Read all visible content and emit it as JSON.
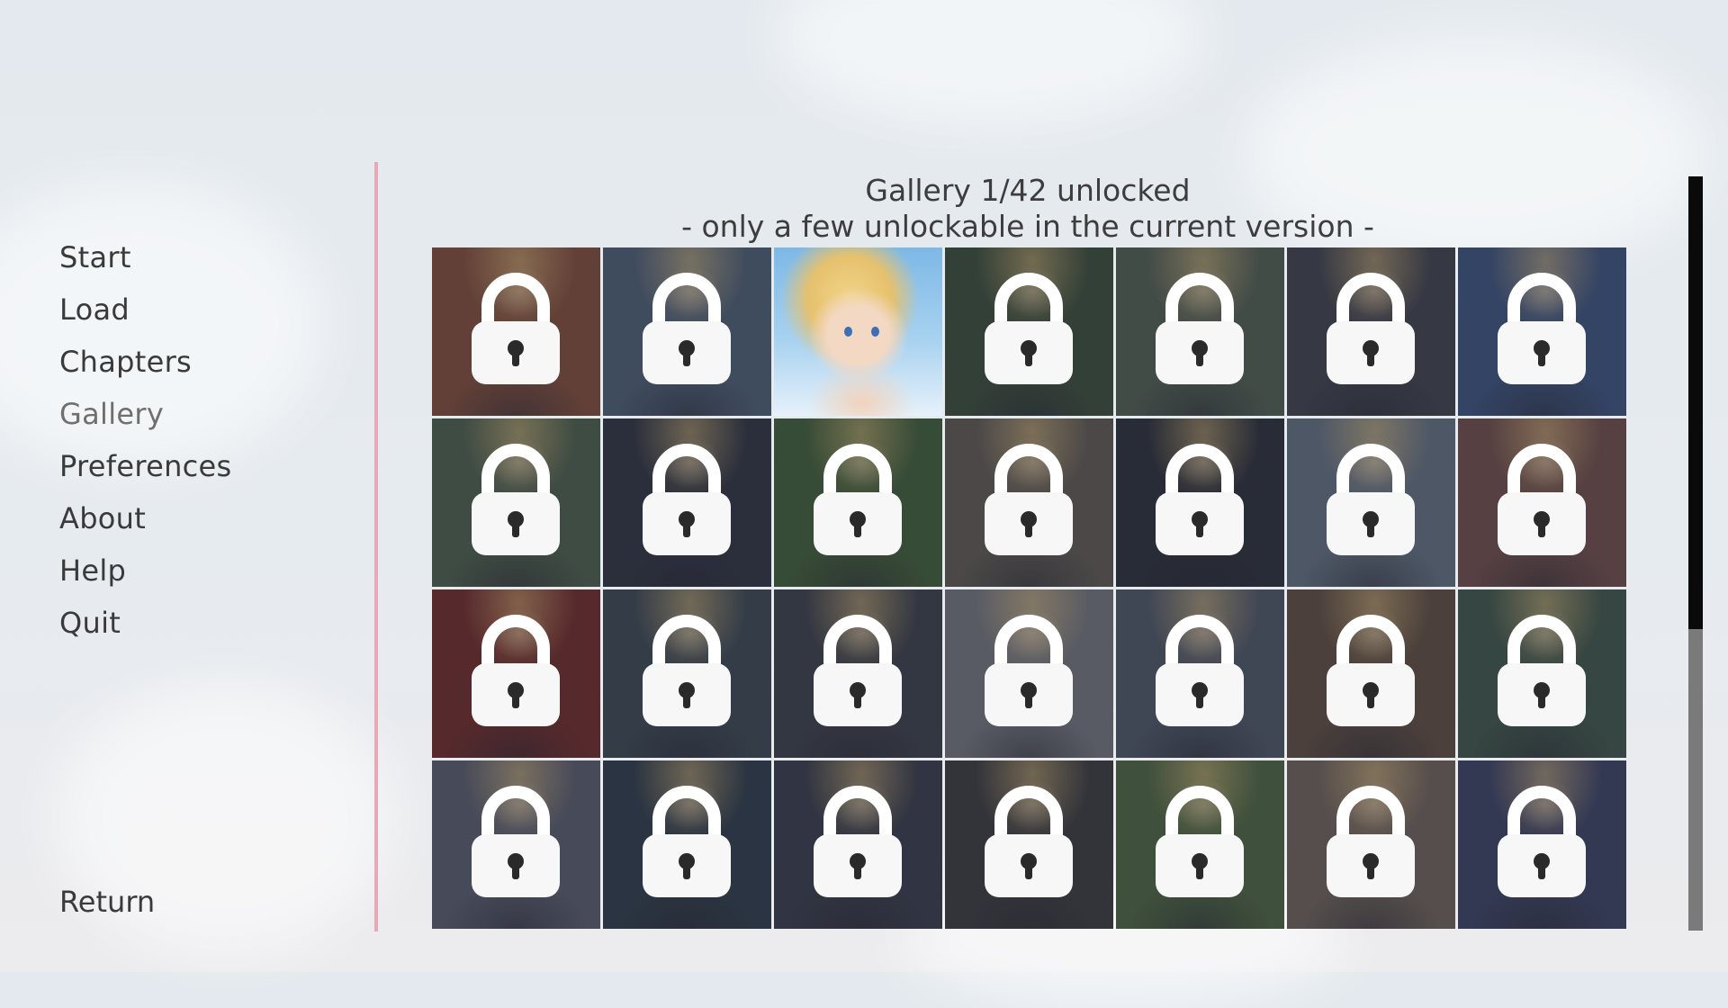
{
  "menu": {
    "items": [
      {
        "label": "Start",
        "active": false
      },
      {
        "label": "Load",
        "active": false
      },
      {
        "label": "Chapters",
        "active": false
      },
      {
        "label": "Gallery",
        "active": true
      },
      {
        "label": "Preferences",
        "active": false
      },
      {
        "label": "About",
        "active": false
      },
      {
        "label": "Help",
        "active": false
      },
      {
        "label": "Quit",
        "active": false
      }
    ],
    "return_label": "Return"
  },
  "gallery": {
    "title": "Gallery 1/42 unlocked",
    "subtitle": "- only a few unlockable in the current version -",
    "columns": 7,
    "tiles": [
      {
        "locked": true,
        "tint": "#7a4a3a"
      },
      {
        "locked": true,
        "tint": "#4a5a70"
      },
      {
        "locked": false,
        "tint": "#8ec1ea"
      },
      {
        "locked": true,
        "tint": "#3a4a3a"
      },
      {
        "locked": true,
        "tint": "#4e5a50"
      },
      {
        "locked": true,
        "tint": "#3d3f4a"
      },
      {
        "locked": true,
        "tint": "#3a4f78"
      },
      {
        "locked": true,
        "tint": "#4a5a4a"
      },
      {
        "locked": true,
        "tint": "#2e3340"
      },
      {
        "locked": true,
        "tint": "#3f5a38"
      },
      {
        "locked": true,
        "tint": "#5a5550"
      },
      {
        "locked": true,
        "tint": "#2a2e38"
      },
      {
        "locked": true,
        "tint": "#5e6a7a"
      },
      {
        "locked": true,
        "tint": "#6a4a48"
      },
      {
        "locked": true,
        "tint": "#6a2a2a"
      },
      {
        "locked": true,
        "tint": "#3a4550"
      },
      {
        "locked": true,
        "tint": "#3a3e48"
      },
      {
        "locked": true,
        "tint": "#6e7078"
      },
      {
        "locked": true,
        "tint": "#4a5262"
      },
      {
        "locked": true,
        "tint": "#5a4a40"
      },
      {
        "locked": true,
        "tint": "#3e5248"
      },
      {
        "locked": true,
        "tint": "#545868"
      },
      {
        "locked": true,
        "tint": "#2e3a48"
      },
      {
        "locked": true,
        "tint": "#363a48"
      },
      {
        "locked": true,
        "tint": "#3a3a3e"
      },
      {
        "locked": true,
        "tint": "#4a6040"
      },
      {
        "locked": true,
        "tint": "#6a5e58"
      },
      {
        "locked": true,
        "tint": "#3a4060"
      }
    ]
  },
  "scrollbar": {
    "position": 0.6
  }
}
